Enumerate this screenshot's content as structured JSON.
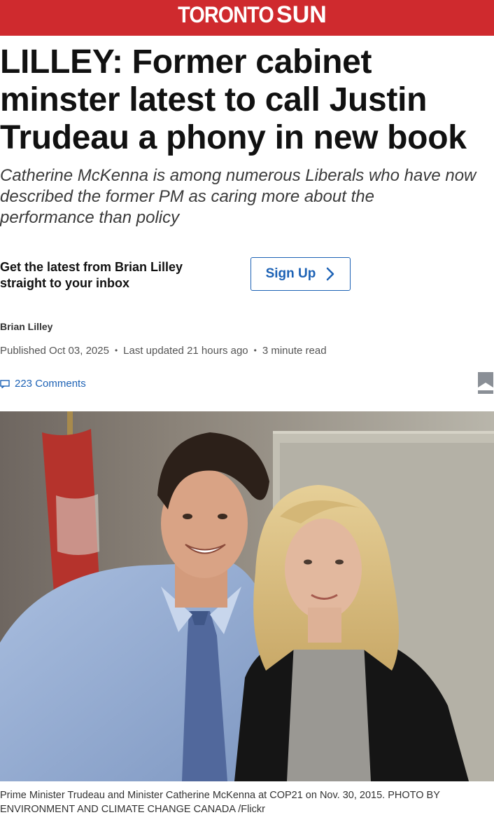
{
  "masthead": {
    "brand_first": "TORONTO",
    "brand_second": "SUN",
    "color": "#cf2a2e"
  },
  "article": {
    "headline_lines": [
      "LILLEY: Former cabinet",
      "minster latest to call Justin",
      "Trudeau a phony in new book"
    ],
    "deck_lines": [
      "Catherine McKenna is among numerous Liberals who have now",
      "described the former PM as caring more about the",
      "performance than policy"
    ]
  },
  "newsletter": {
    "text_lines": [
      "Get the latest from Brian Lilley",
      "straight to your inbox"
    ],
    "button_label": "Sign Up"
  },
  "byline": {
    "author": "Brian Lilley",
    "published": "Published Oct 03, 2025",
    "updated": "Last updated 21 hours ago",
    "read_time": "3 minute read",
    "separator": "•"
  },
  "comments": {
    "label": "223 Comments",
    "icon": "comment-icon"
  },
  "bookmark": {
    "icon": "bookmark-icon"
  },
  "photo": {
    "caption_lines": [
      "Prime Minister Trudeau and Minister Catherine McKenna at COP21 on Nov. 30, 2015. PHOTO BY",
      "ENVIRONMENT AND CLIMATE CHANGE CANADA /Flickr"
    ]
  },
  "colors": {
    "accent": "#cf2a2e",
    "link": "#1d62b5"
  }
}
